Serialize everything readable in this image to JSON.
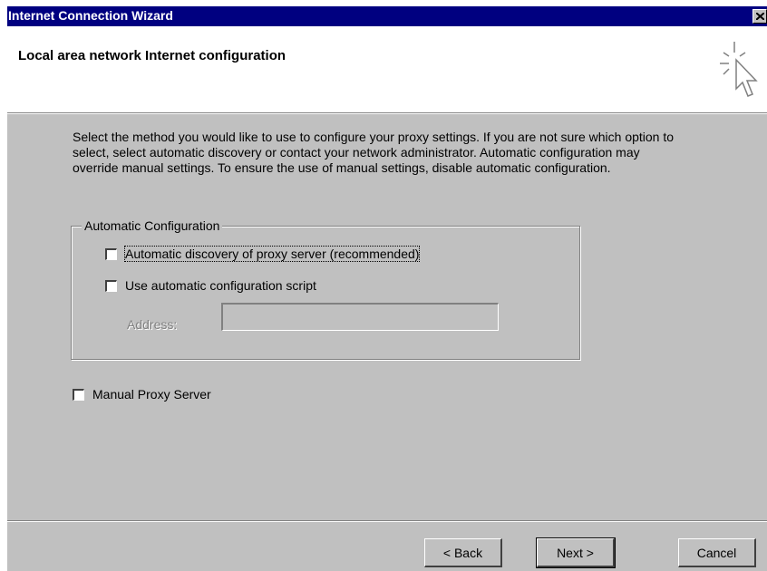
{
  "window": {
    "title": "Internet Connection Wizard"
  },
  "header": {
    "heading": "Local area network Internet configuration"
  },
  "description": "Select the method you would like to use to configure your proxy settings.  If you are not sure which option to select, select automatic discovery or contact your network administrator.  Automatic configuration may override manual settings.  To ensure the use of manual settings, disable automatic configuration.",
  "auto_config": {
    "group_label": "Automatic Configuration",
    "auto_discovery": {
      "label": "Automatic discovery of proxy server (recommended)",
      "checked": false
    },
    "auto_script": {
      "label": "Use automatic configuration script",
      "checked": false
    },
    "address": {
      "label": "Address:",
      "value": ""
    }
  },
  "manual_proxy": {
    "label": "Manual Proxy Server",
    "checked": false
  },
  "buttons": {
    "back": "< Back",
    "next": "Next >",
    "cancel": "Cancel"
  },
  "icons": {
    "close": "close-icon",
    "wizard": "wizard-cursor-icon"
  },
  "colors": {
    "titlebar": "#000080",
    "face": "#c0c0c0",
    "header_bg": "#ffffff"
  }
}
